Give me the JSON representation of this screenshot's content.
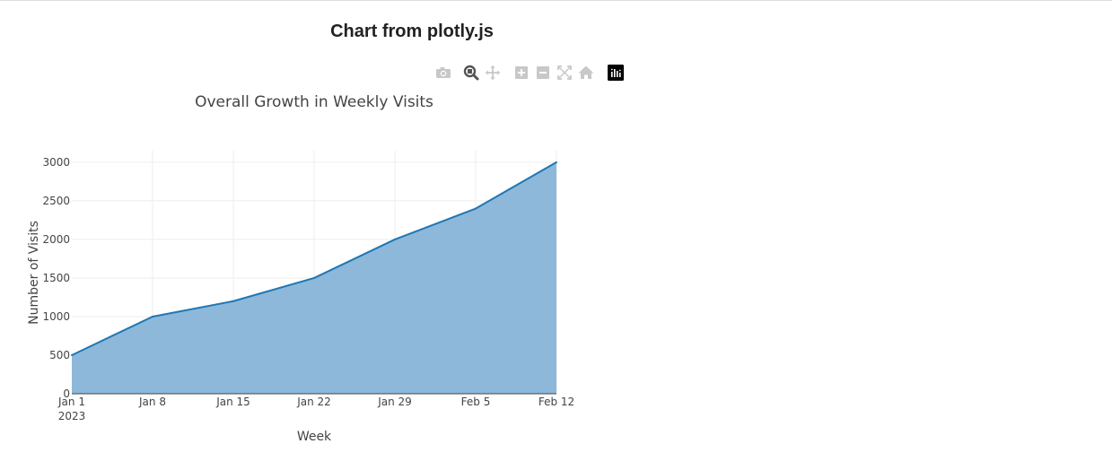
{
  "page": {
    "heading": "Chart from plotly.js"
  },
  "modebar": {
    "buttons": [
      {
        "name": "camera-icon",
        "active": false
      },
      {
        "name": "zoom-icon",
        "active": true
      },
      {
        "name": "pan-icon",
        "active": false
      },
      {
        "name": "zoom-in-icon",
        "active": false
      },
      {
        "name": "zoom-out-icon",
        "active": false
      },
      {
        "name": "autoscale-icon",
        "active": false
      },
      {
        "name": "home-icon",
        "active": false
      },
      {
        "name": "plotly-logo-icon",
        "active": false
      }
    ],
    "colors": {
      "inactive": "#c8c8c8",
      "active": "#555555",
      "logo": "#000000"
    }
  },
  "chart_data": {
    "type": "area",
    "title": "Overall Growth in Weekly Visits",
    "xlabel": "Week",
    "ylabel": "Number of Visits",
    "x": [
      "2023-01-01",
      "2023-01-08",
      "2023-01-15",
      "2023-01-22",
      "2023-01-29",
      "2023-02-05",
      "2023-02-12"
    ],
    "x_tick_labels": [
      "Jan 1",
      "Jan 8",
      "Jan 15",
      "Jan 22",
      "Jan 29",
      "Feb 5",
      "Feb 12"
    ],
    "x_year_label": "2023",
    "series": [
      {
        "values": [
          500,
          1000,
          1200,
          1500,
          2000,
          2400,
          3000
        ],
        "line_color": "#1f77b4",
        "fill_color": "#8db8d9"
      }
    ],
    "ylim": [
      0,
      3150
    ],
    "y_ticks": [
      0,
      500,
      1000,
      1500,
      2000,
      2500,
      3000
    ],
    "grid": true,
    "grid_color": "#eeeeee"
  }
}
